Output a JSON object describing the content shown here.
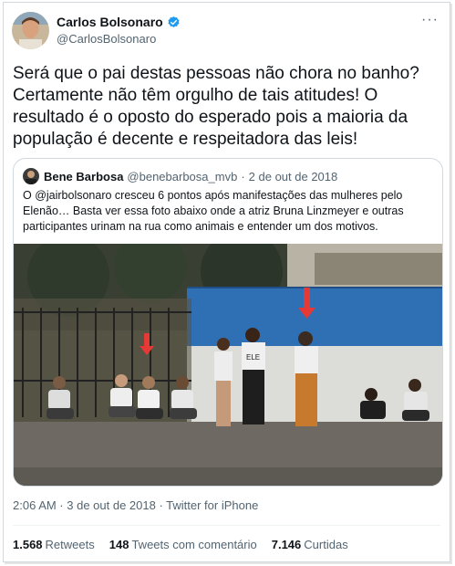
{
  "author": {
    "name": "Carlos Bolsonaro",
    "handle": "@CarlosBolsonaro"
  },
  "tweet": {
    "text": "Será que o pai destas pessoas não chora no banho? Certamente não têm orgulho de tais atitudes! O resultado é o oposto do esperado pois a maioria da população é decente e respeitadora das leis!"
  },
  "quoted": {
    "name": "Bene Barbosa",
    "handle": "@benebarbosa_mvb",
    "separator": "·",
    "date": "2 de out de 2018",
    "text": "O @jairbolsonaro cresceu 6 pontos após manifestações das mulheres pelo Elenão… Basta ver essa foto abaixo onde a atriz Bruna Linzmeyer e outras participantes urinam na rua como animais e entender um dos motivos.",
    "photo_shirt_text": "ELE"
  },
  "timestamp": "2:06 AM · 3 de out de 2018 · Twitter for iPhone",
  "stats": [
    {
      "value": "1.568",
      "label": "Retweets"
    },
    {
      "value": "148",
      "label": "Tweets com comentário"
    },
    {
      "value": "7.146",
      "label": "Curtidas"
    }
  ],
  "more_label": "···",
  "colors": {
    "verified": "#1d9bf0",
    "secondary_text": "#536471",
    "wall_blue": "#2f6fb3",
    "arrow_red": "#e53935"
  },
  "icons": {
    "verified": "verified-badge-icon",
    "more": "more-options-icon"
  }
}
